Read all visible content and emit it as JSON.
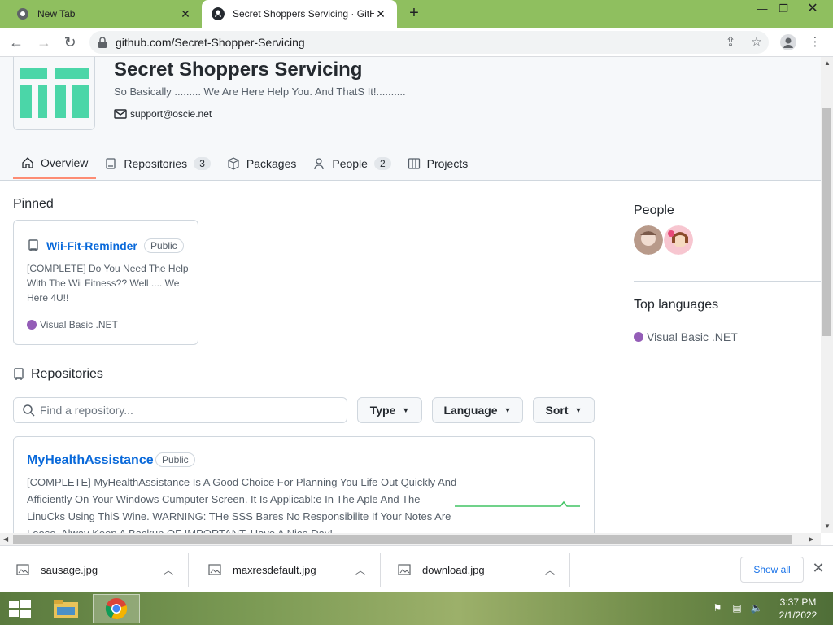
{
  "browser": {
    "tabs": [
      {
        "title": "New Tab"
      },
      {
        "title": "Secret Shoppers Servicing · GitHub"
      }
    ],
    "url": "github.com/Secret-Shopper-Servicing"
  },
  "org": {
    "name": "Secret Shoppers Servicing",
    "description": "So Basically ......... We Are Here Help You. And ThatS It!..........",
    "email": "support@oscie.net",
    "tabs": [
      {
        "label": "Overview"
      },
      {
        "label": "Repositories",
        "count": "3"
      },
      {
        "label": "Packages"
      },
      {
        "label": "People",
        "count": "2"
      },
      {
        "label": "Projects"
      }
    ]
  },
  "pinned": {
    "heading": "Pinned",
    "repo": {
      "name": "Wii-Fit-Reminder",
      "visibility": "Public",
      "description": "[COMPLETE] Do You Need The Help With The Wii Fitness?? Well .... We Here 4U!!",
      "language": "Visual Basic .NET"
    }
  },
  "repositories": {
    "heading": "Repositories",
    "search_placeholder": "Find a repository...",
    "filters": {
      "type": "Type",
      "language": "Language",
      "sort": "Sort"
    },
    "items": [
      {
        "name": "MyHealthAssistance",
        "visibility": "Public",
        "description": "[COMPLETE] MyHealthAssistance Is A Good Choice For Planning You Life Out Quickly And Afficiently On Your Windows Cumputer Screen. It Is Applicabl:e In The Aple And The LinuCks Using ThiS Wine. WARNING: THe SSS Bares No Responsibilite If Your Notes Are Loose, Alway Keep A Backup OF IMPORTANT. Have A Nice Day!"
      }
    ]
  },
  "sidebar": {
    "people_heading": "People",
    "languages_heading": "Top languages",
    "top_language": "Visual Basic .NET"
  },
  "downloads": {
    "items": [
      {
        "name": "sausage.jpg"
      },
      {
        "name": "maxresdefault.jpg"
      },
      {
        "name": "download.jpg"
      }
    ],
    "show_all": "Show all"
  },
  "taskbar": {
    "time": "3:37 PM",
    "date": "2/1/2022"
  },
  "colors": {
    "link": "#0969da",
    "lang_vbnet": "#945db7",
    "tab_underline": "#fd8c73",
    "chrome_frame": "#8fbf5f"
  }
}
